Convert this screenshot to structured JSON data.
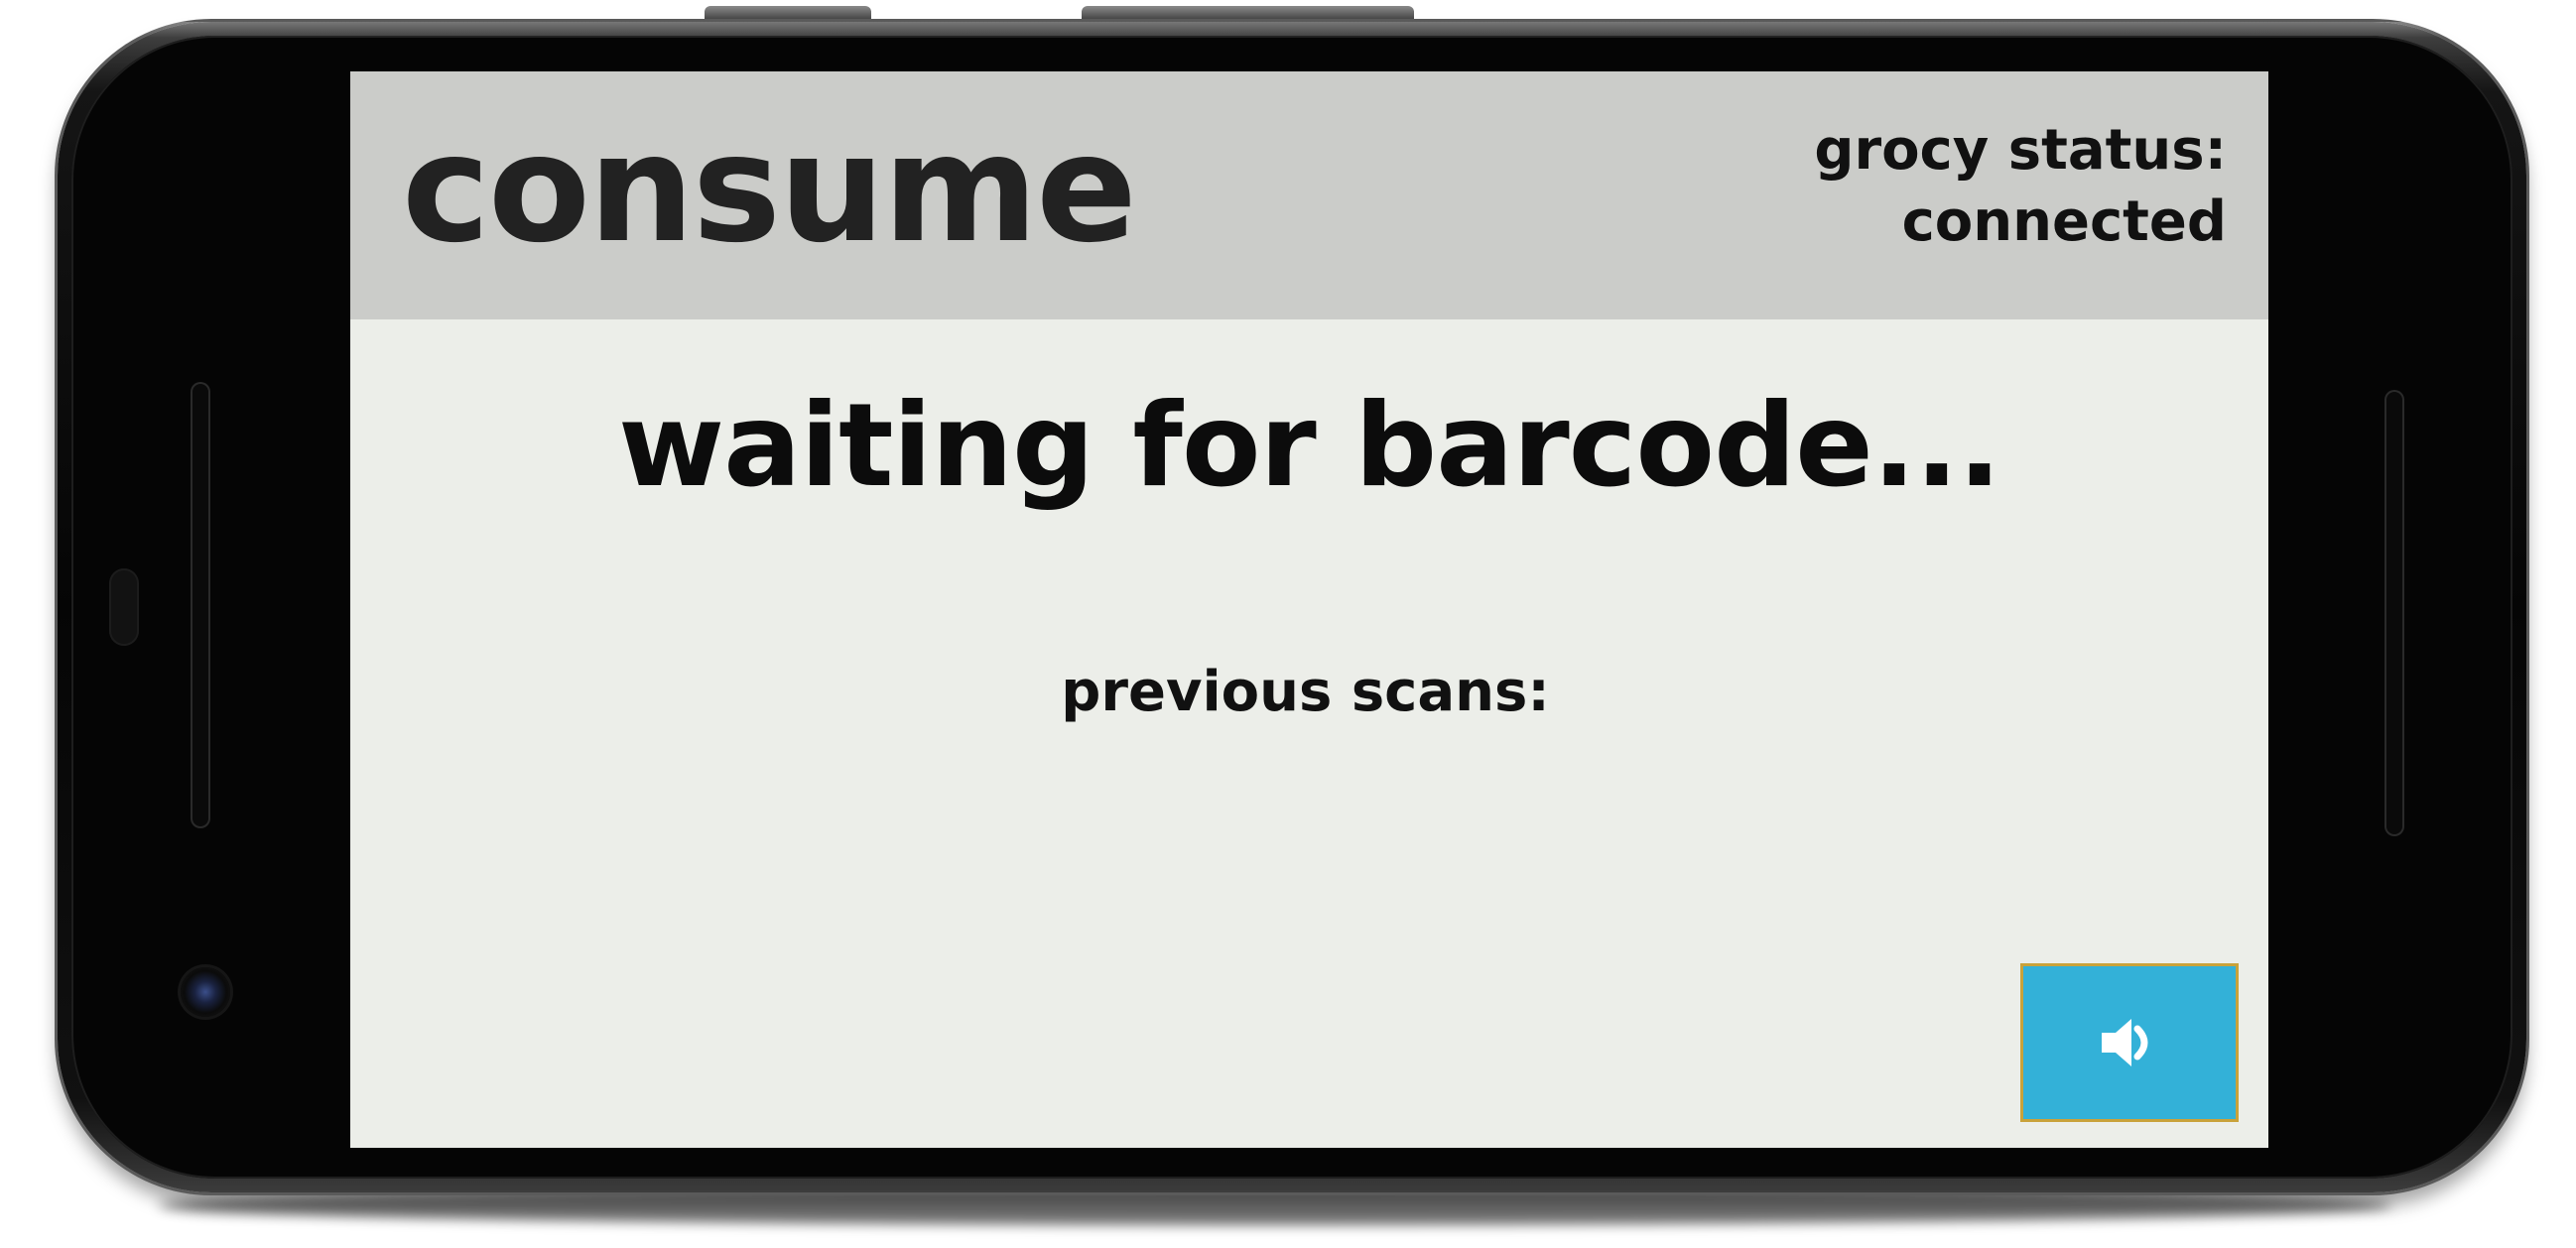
{
  "app": {
    "mode_title": "consume",
    "status": {
      "line1": "grocy status:",
      "line2": "connected"
    },
    "waiting_message": "waiting for barcode...",
    "previous_scans_label": "previous scans:",
    "previous_scans": []
  },
  "controls": {
    "sound_button_icon": "speaker-volume-icon"
  },
  "colors": {
    "header_bg": "#cbccc9",
    "screen_bg": "#eceee9",
    "button_bg": "#33b1d8",
    "button_border": "#c9a23a",
    "text": "#111111"
  }
}
